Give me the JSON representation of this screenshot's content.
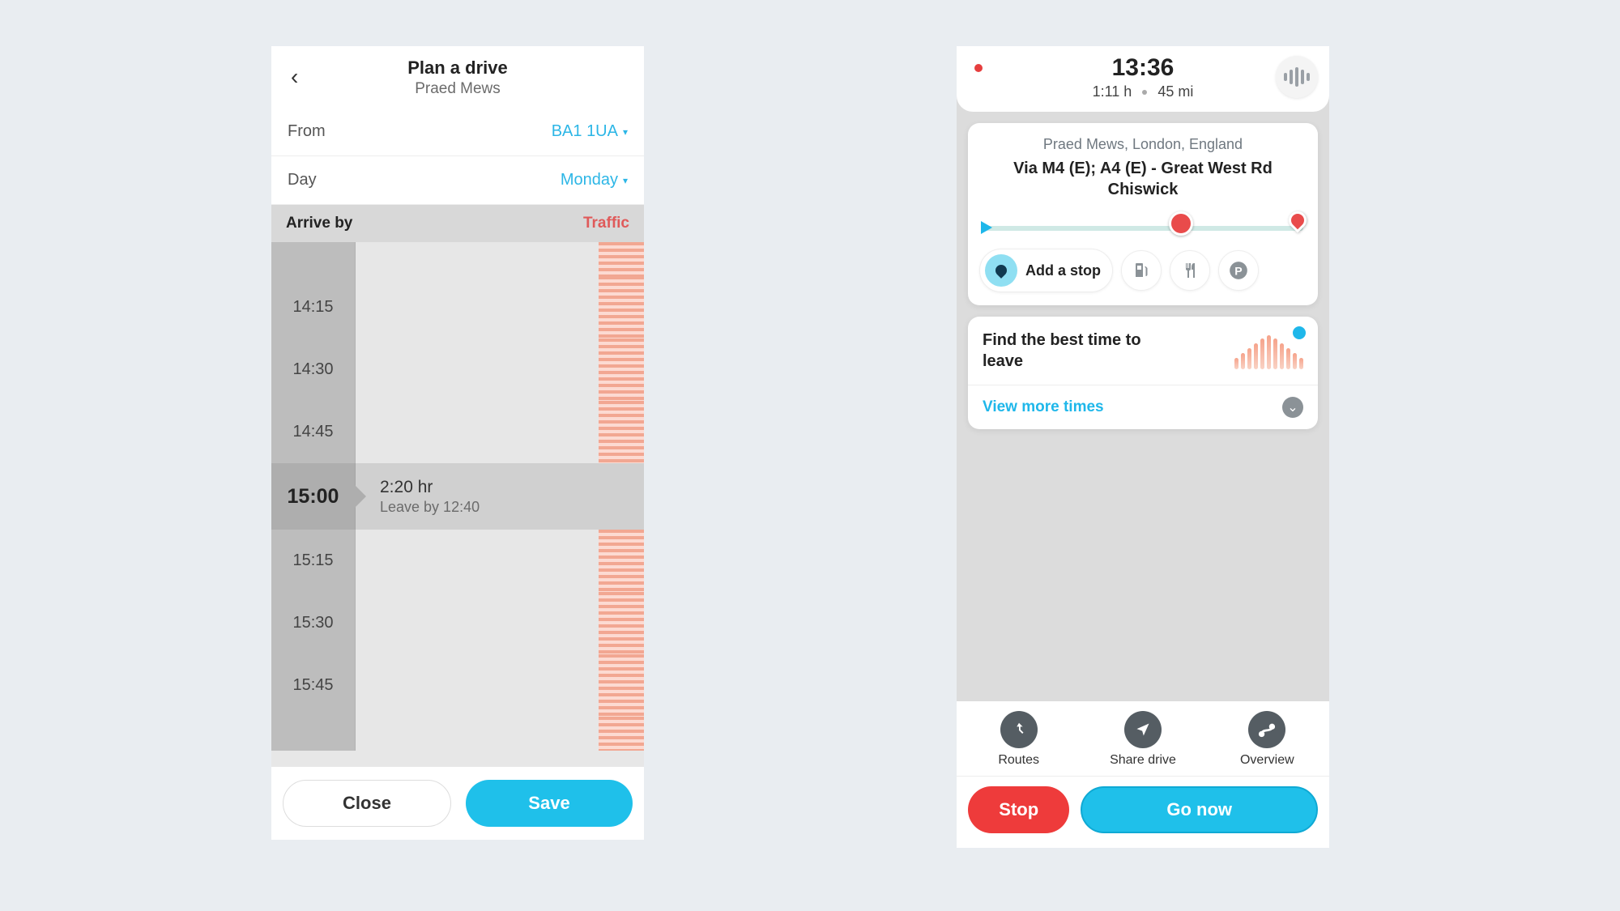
{
  "planDrive": {
    "title": "Plan a drive",
    "subtitle": "Praed Mews",
    "from_label": "From",
    "from_value": "BA1 1UA",
    "day_label": "Day",
    "day_value": "Monday",
    "arrive_label": "Arrive by",
    "traffic_label": "Traffic",
    "times": [
      "14:15",
      "14:30",
      "14:45",
      "15:00",
      "15:15",
      "15:30",
      "15:45"
    ],
    "selected": {
      "time": "15:00",
      "duration": "2:20 hr",
      "leave": "Leave by 12:40"
    },
    "close": "Close",
    "save": "Save"
  },
  "nav": {
    "clock": "13:36",
    "eta_time": "1:11 h",
    "eta_dist": "45 mi",
    "location": "Praed Mews, London, England",
    "via": "Via M4 (E); A4 (E) - Great West Rd Chiswick",
    "add_stop": "Add a stop",
    "best_time": "Find the best time to leave",
    "view_more": "View more times",
    "routes": "Routes",
    "share": "Share drive",
    "overview": "Overview",
    "stop": "Stop",
    "go": "Go now"
  }
}
